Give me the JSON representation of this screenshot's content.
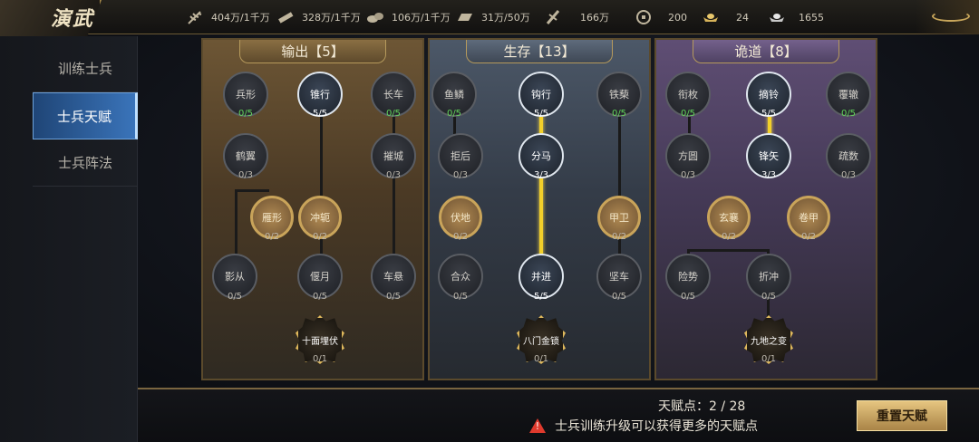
{
  "topbar": {
    "title": "演武",
    "resources": [
      {
        "icon": "wheat-icon",
        "value": "404万/1千万"
      },
      {
        "icon": "wood-icon",
        "value": "328万/1千万"
      },
      {
        "icon": "stone-icon",
        "value": "106万/1千万"
      },
      {
        "icon": "iron-icon",
        "value": "31万/50万"
      },
      {
        "icon": "token-icon",
        "value": "166万"
      },
      {
        "icon": "coin-icon",
        "value": "200"
      },
      {
        "icon": "gold-ingot-icon",
        "value": "24"
      },
      {
        "icon": "silver-ingot-icon",
        "value": "1655"
      }
    ]
  },
  "sidebar": {
    "tabs": [
      {
        "label": "训练士兵",
        "active": false
      },
      {
        "label": "士兵天赋",
        "active": true
      },
      {
        "label": "士兵阵法",
        "active": false
      }
    ]
  },
  "panels": [
    {
      "title": "输出【5】",
      "nodes": {
        "bingxing": {
          "name": "兵形",
          "count": "0/5"
        },
        "zhuixing": {
          "name": "锥行",
          "count": "5/5"
        },
        "changche": {
          "name": "长车",
          "count": "0/5"
        },
        "heyi": {
          "name": "鹤翼",
          "count": "0/3"
        },
        "cuicheng": {
          "name": "摧城",
          "count": "0/3"
        },
        "yanxing": {
          "name": "雁形",
          "count": "0/2"
        },
        "chongheng": {
          "name": "冲轭",
          "count": "0/2"
        },
        "yingcong": {
          "name": "影从",
          "count": "0/5"
        },
        "yanyue": {
          "name": "偃月",
          "count": "0/5"
        },
        "chexuan": {
          "name": "车悬",
          "count": "0/5"
        },
        "ultimate": {
          "name": "十面埋伏",
          "count": "0/1"
        }
      }
    },
    {
      "title": "生存【13】",
      "nodes": {
        "yulin": {
          "name": "鱼鳞",
          "count": "0/5"
        },
        "gouxing": {
          "name": "钩行",
          "count": "5/5"
        },
        "tieli": {
          "name": "铁蔾",
          "count": "0/5"
        },
        "juhou": {
          "name": "拒后",
          "count": "0/3"
        },
        "fenma": {
          "name": "分马",
          "count": "3/3"
        },
        "fudi": {
          "name": "伏地",
          "count": "0/2"
        },
        "jiawei": {
          "name": "甲卫",
          "count": "0/2"
        },
        "hezhong": {
          "name": "合众",
          "count": "0/5"
        },
        "bingjin": {
          "name": "并进",
          "count": "5/5"
        },
        "jianche": {
          "name": "坚车",
          "count": "0/5"
        },
        "ultimate": {
          "name": "八门金锁",
          "count": "0/1"
        }
      }
    },
    {
      "title": "诡道【8】",
      "nodes": {
        "hengmei": {
          "name": "衔枚",
          "count": "0/5"
        },
        "zhiling": {
          "name": "摘铃",
          "count": "5/5"
        },
        "fuzhe": {
          "name": "覆辙",
          "count": "0/5"
        },
        "fangyuan": {
          "name": "方圆",
          "count": "0/3"
        },
        "fengshi": {
          "name": "锋矢",
          "count": "3/3"
        },
        "shushu": {
          "name": "疏数",
          "count": "0/3"
        },
        "xuanxiang": {
          "name": "玄襄",
          "count": "0/2"
        },
        "juanjia": {
          "name": "卷甲",
          "count": "0/2"
        },
        "xianshi": {
          "name": "险势",
          "count": "0/5"
        },
        "zhechong": {
          "name": "折冲",
          "count": "0/5"
        },
        "ultimate": {
          "name": "九地之变",
          "count": "0/1"
        }
      }
    }
  ],
  "bottom": {
    "points_label": "天赋点：2 / 28",
    "hint": "士兵训练升级可以获得更多的天赋点",
    "warning_icon": "!",
    "reset_label": "重置天赋"
  },
  "colors": {
    "accent_gold": "#c9a45a",
    "active_line": "#f2cf2a",
    "maxed_count": "#62d45b",
    "active_tab": "#3a74ba"
  }
}
